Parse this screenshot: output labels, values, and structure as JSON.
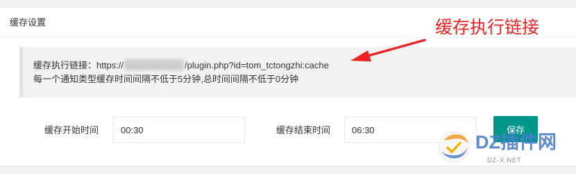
{
  "panel": {
    "title": "缓存设置"
  },
  "notice": {
    "link_label": "缓存执行链接：",
    "url_prefix": "https://",
    "url_suffix": "/plugin.php?id=tom_tctongzhi:cache",
    "description": "每一个通知类型缓存时间间隔不低于5分钟,总时间间隔不低于0分钟"
  },
  "annotation": {
    "label": "缓存执行链接",
    "color": "#ee2222"
  },
  "form": {
    "start_label": "缓存开始时间",
    "start_value": "00:30",
    "end_label": "缓存结束时间",
    "end_value": "06:30",
    "save_label": "保存"
  },
  "watermark": {
    "text": "DZ插件网",
    "subtext": "DZ-X.NET"
  },
  "colors": {
    "accent": "#009688",
    "annotation": "#ee2222",
    "watermark": "#4a7fd0"
  }
}
